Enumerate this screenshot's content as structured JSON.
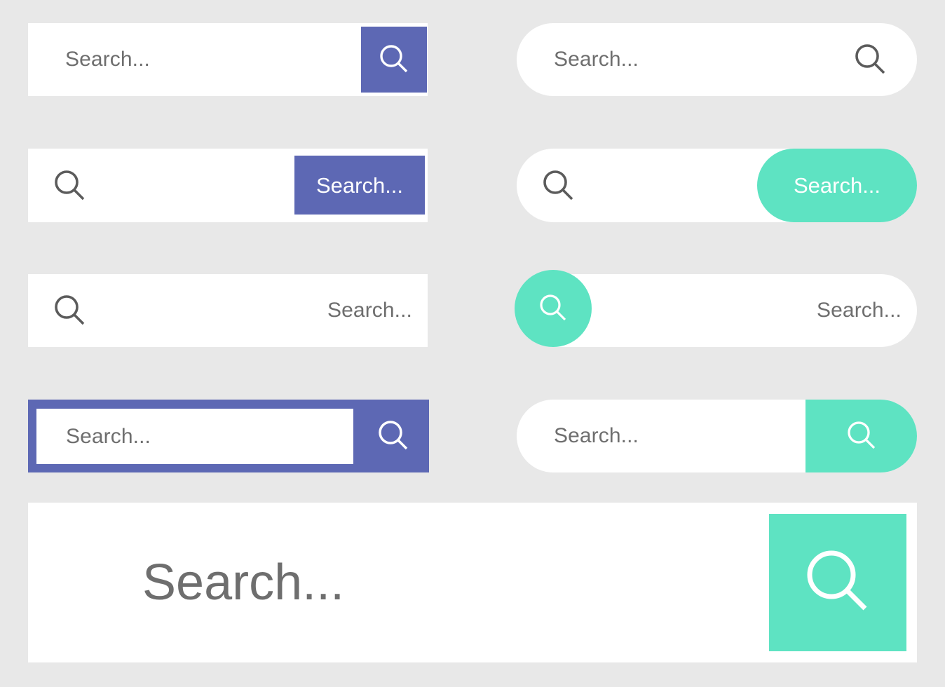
{
  "meta": {
    "title": "Search Bar UI Component Set",
    "background_color": "#e8e8e8"
  },
  "colors": {
    "indigo": "#5d68b4",
    "mint": "#5ee3c2",
    "placeholder_text": "#6e6e6e",
    "surface": "#ffffff",
    "on_fill_text": "#ffffff"
  },
  "icons": {
    "search": "search-icon",
    "magnifier": "magnifier-icon"
  },
  "components": [
    {
      "id": "square-bar-indigo-icon-button",
      "placeholder": "Search...",
      "button_label": "",
      "shape": "square",
      "accent": "#5d68b4"
    },
    {
      "id": "pill-bar-plain-icon-right",
      "placeholder": "Search...",
      "button_label": "",
      "shape": "pill",
      "accent": "#6e6e6e"
    },
    {
      "id": "square-bar-indigo-text-button",
      "placeholder": "",
      "button_label": "Search...",
      "shape": "square",
      "accent": "#5d68b4"
    },
    {
      "id": "pill-bar-mint-text-button",
      "placeholder": "",
      "button_label": "Search...",
      "shape": "pill",
      "accent": "#5ee3c2"
    },
    {
      "id": "square-bar-icon-left-text-right",
      "placeholder": "Search...",
      "button_label": "",
      "shape": "square",
      "accent": "#6e6e6e"
    },
    {
      "id": "pill-bar-mint-circle-icon-left",
      "placeholder": "Search...",
      "button_label": "",
      "shape": "pill",
      "accent": "#5ee3c2"
    },
    {
      "id": "indigo-framed-bar-with-icon",
      "placeholder": "Search...",
      "button_label": "",
      "shape": "square-framed",
      "accent": "#5d68b4"
    },
    {
      "id": "pill-bar-mint-icon-cap",
      "placeholder": "Search...",
      "button_label": "",
      "shape": "pill",
      "accent": "#5ee3c2"
    },
    {
      "id": "hero-bar-mint-square-icon",
      "placeholder": "Search...",
      "button_label": "",
      "shape": "square",
      "accent": "#5ee3c2"
    }
  ]
}
